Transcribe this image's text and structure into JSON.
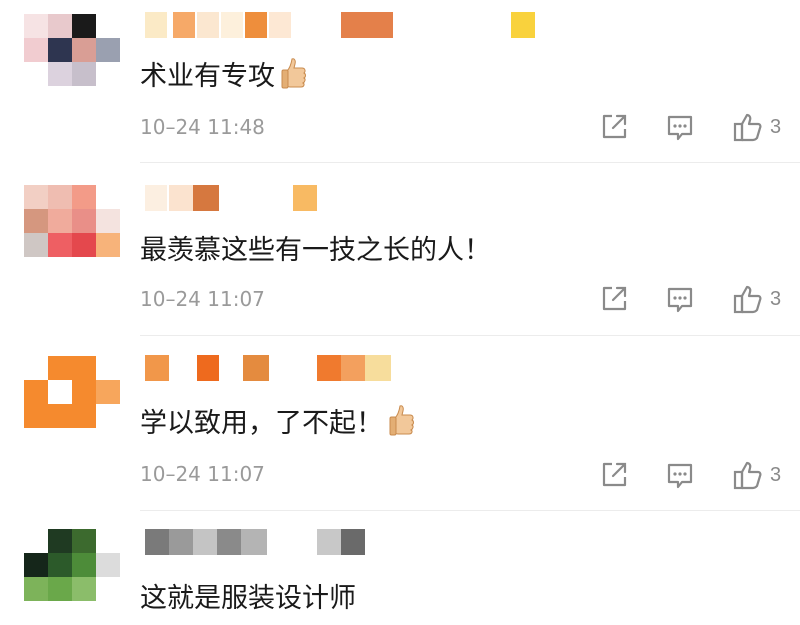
{
  "comments": [
    {
      "text": "术业有专攻",
      "time": "10–24 11:48",
      "likes": "3",
      "has_emoji": true
    },
    {
      "text": "最羡慕这些有一技之长的人！",
      "time": "10–24 11:07",
      "likes": "3",
      "has_emoji": false
    },
    {
      "text": "学以致用，了不起！",
      "time": "10–24 11:07",
      "likes": "3",
      "has_emoji": true
    },
    {
      "text": "这就是服装设计师",
      "time": "",
      "likes": "",
      "has_emoji": false
    }
  ],
  "icons": {
    "share": "share-icon",
    "reply": "comment-icon",
    "like": "thumbs-up-icon",
    "emoji": "thumbs-up-emoji"
  },
  "colors": {
    "text": "#1a1a1a",
    "meta": "#9a9a9a",
    "icon": "#8a8a8a",
    "divider": "#ececec"
  }
}
